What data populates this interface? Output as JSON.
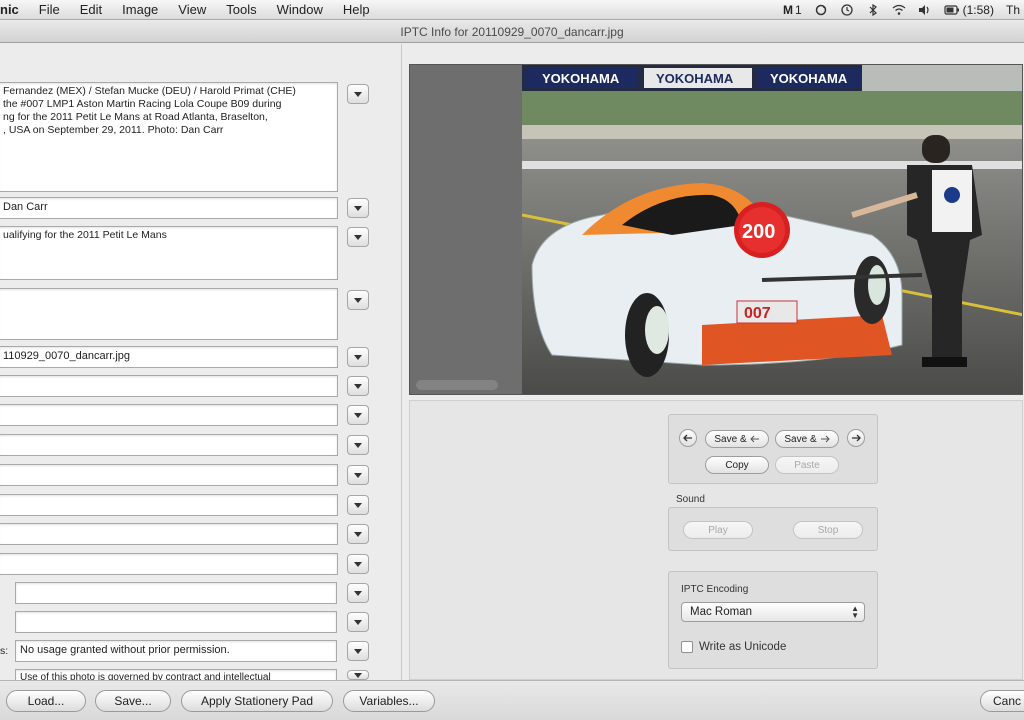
{
  "menubar": {
    "app_name": "nic",
    "items": [
      "File",
      "Edit",
      "Image",
      "View",
      "Tools",
      "Window",
      "Help"
    ],
    "status_badge": "1",
    "battery_time": "(1:58)",
    "clock_partial": "Th"
  },
  "window": {
    "title": "IPTC Info for 20110929_0070_dancarr.jpg"
  },
  "form": {
    "caption": "Fernandez (MEX) / Stefan Mucke (DEU) / Harold Primat (CHE)\nthe #007 LMP1 Aston Martin Racing Lola Coupe B09 during\nng for the 2011 Petit Le Mans at Road Atlanta, Braselton,\n, USA on September 29, 2011. Photo: Dan Carr",
    "writer": "Dan Carr",
    "headline": "ualifying for the 2011 Petit Le Mans",
    "instructions": "",
    "filename": "110929_0070_dancarr.jpg",
    "rights_label": "s:",
    "rights_usage": "No usage granted without prior permission.",
    "copyright_notice": "Use of this photo is governed by contract and intellectual"
  },
  "navigation": {
    "save_next_label": "Save &",
    "save_prev_label": "Save &",
    "copy_label": "Copy",
    "paste_label": "Paste"
  },
  "sound": {
    "label": "Sound",
    "play_label": "Play",
    "stop_label": "Stop"
  },
  "encoding": {
    "label": "IPTC Encoding",
    "selected": "Mac Roman",
    "unicode_label": "Write as Unicode",
    "unicode_checked": false
  },
  "photo": {
    "banner_text": "YOKOHAMA",
    "car_number": "007",
    "pit_board": "200"
  },
  "bottom": {
    "load_label": "Load...",
    "save_label": "Save...",
    "stationery_label": "Apply Stationery Pad",
    "variables_label": "Variables...",
    "cancel_label": "Canc"
  }
}
